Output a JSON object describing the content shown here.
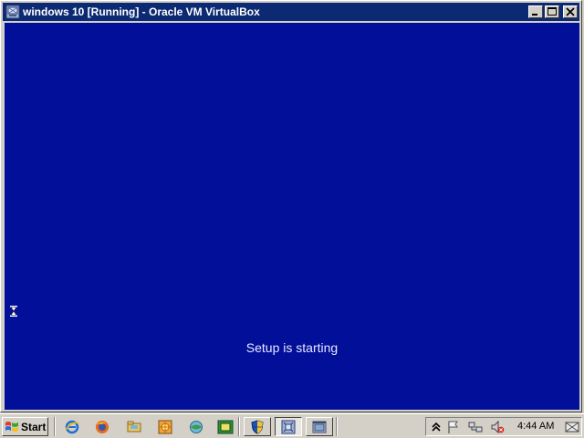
{
  "window": {
    "title": "windows 10 [Running] - Oracle VM VirtualBox",
    "icon": "virtualbox-app-icon",
    "buttons": [
      "minimize-icon",
      "maximize-icon",
      "close-icon"
    ]
  },
  "vm_screen": {
    "background_color": "#020f99",
    "message": "Setup is starting",
    "cursor": "hourglass-icon"
  },
  "taskbar": {
    "start_label": "Start",
    "quick_launch": [
      "internet-explorer-icon",
      "firefox-icon",
      "folder-icon",
      "media-icon",
      "network-icon",
      "app-icon"
    ],
    "task_buttons": [
      "shield-task-icon",
      "virtualbox-task-icon",
      "window-task-icon"
    ],
    "tray_icons": [
      "chevron-up-icon",
      "flag-icon",
      "network-icon",
      "volume-muted-icon"
    ],
    "clock": "4:44 AM"
  }
}
